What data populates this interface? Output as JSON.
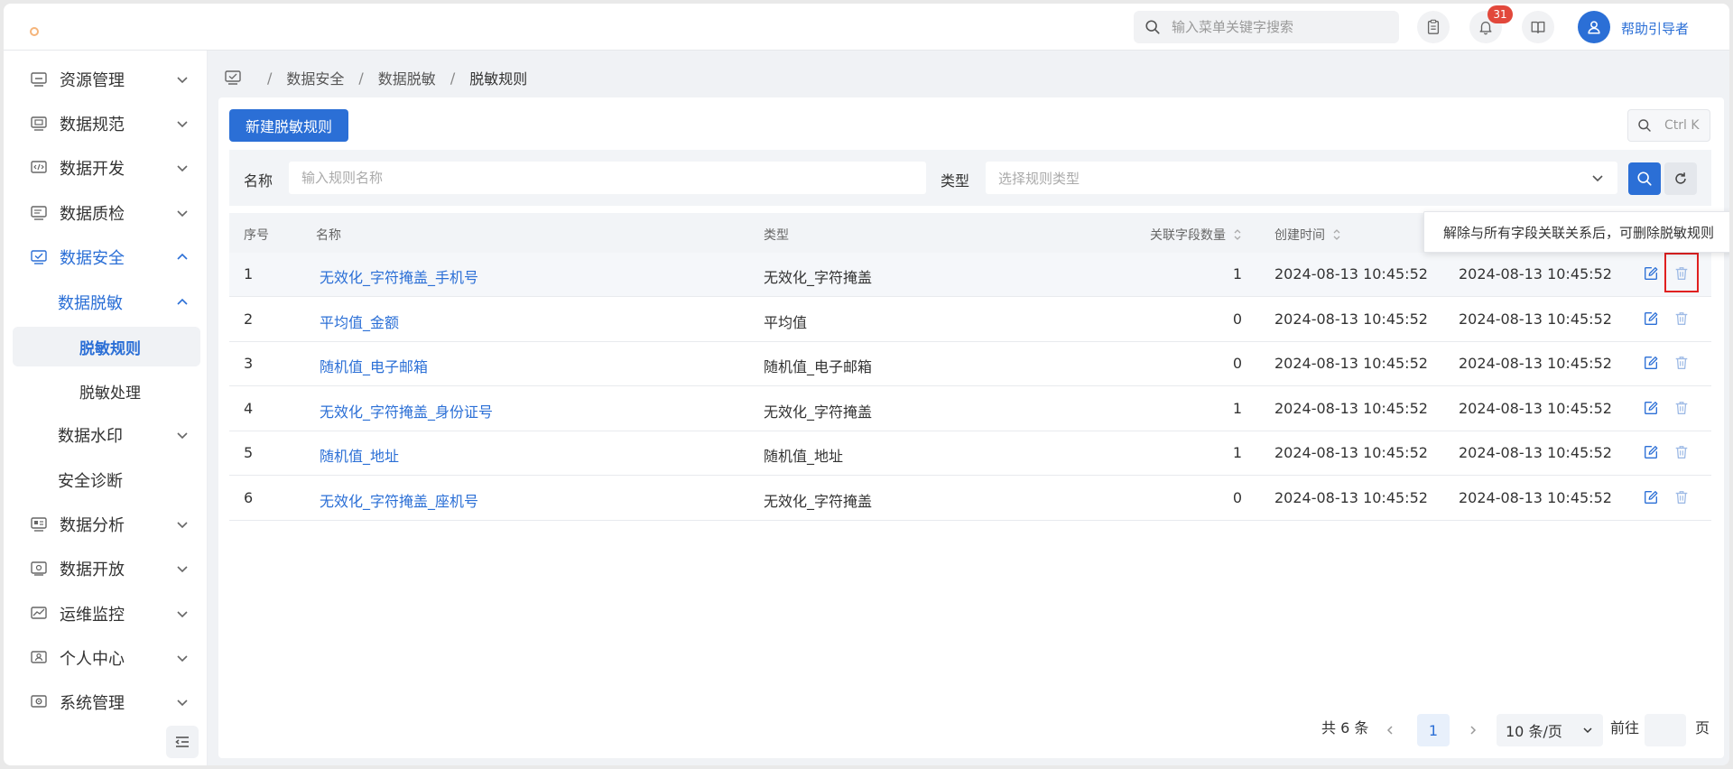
{
  "topbar": {
    "search_placeholder": "输入菜单关键字搜索",
    "notification_count": "31",
    "username": "帮助引导者"
  },
  "sidebar": {
    "items": [
      {
        "label": "资源管理",
        "icon": "resource-icon"
      },
      {
        "label": "数据规范",
        "icon": "standard-icon"
      },
      {
        "label": "数据开发",
        "icon": "code-icon"
      },
      {
        "label": "数据质检",
        "icon": "quality-icon"
      },
      {
        "label": "数据安全",
        "icon": "security-icon"
      },
      {
        "label": "数据脱敏"
      },
      {
        "label": "脱敏规则"
      },
      {
        "label": "脱敏处理"
      },
      {
        "label": "数据水印"
      },
      {
        "label": "安全诊断"
      },
      {
        "label": "数据分析",
        "icon": "analysis-icon"
      },
      {
        "label": "数据开放",
        "icon": "open-icon"
      },
      {
        "label": "运维监控",
        "icon": "monitor-icon"
      },
      {
        "label": "个人中心",
        "icon": "user-center-icon"
      },
      {
        "label": "系统管理",
        "icon": "system-icon"
      }
    ]
  },
  "breadcrumb": [
    "数据安全",
    "数据脱敏",
    "脱敏规则"
  ],
  "toolbar": {
    "new_button": "新建脱敏规则",
    "shortcut": "Ctrl K"
  },
  "filter": {
    "name_label": "名称",
    "name_placeholder": "输入规则名称",
    "type_label": "类型",
    "type_placeholder": "选择规则类型"
  },
  "table": {
    "columns": [
      "序号",
      "名称",
      "类型",
      "关联字段数量",
      "创建时间"
    ],
    "rows": [
      {
        "index": "1",
        "name": "无效化_字符掩盖_手机号",
        "type": "无效化_字符掩盖",
        "count": "1",
        "created": "2024-08-13 10:45:52",
        "updated": "2024-08-13 10:45:52"
      },
      {
        "index": "2",
        "name": "平均值_金额",
        "type": "平均值",
        "count": "0",
        "created": "2024-08-13 10:45:52",
        "updated": "2024-08-13 10:45:52"
      },
      {
        "index": "3",
        "name": "随机值_电子邮箱",
        "type": "随机值_电子邮箱",
        "count": "0",
        "created": "2024-08-13 10:45:52",
        "updated": "2024-08-13 10:45:52"
      },
      {
        "index": "4",
        "name": "无效化_字符掩盖_身份证号",
        "type": "无效化_字符掩盖",
        "count": "1",
        "created": "2024-08-13 10:45:52",
        "updated": "2024-08-13 10:45:52"
      },
      {
        "index": "5",
        "name": "随机值_地址",
        "type": "随机值_地址",
        "count": "1",
        "created": "2024-08-13 10:45:52",
        "updated": "2024-08-13 10:45:52"
      },
      {
        "index": "6",
        "name": "无效化_字符掩盖_座机号",
        "type": "无效化_字符掩盖",
        "count": "0",
        "created": "2024-08-13 10:45:52",
        "updated": "2024-08-13 10:45:52"
      }
    ]
  },
  "tooltip": "解除与所有字段关联关系后，可删除脱敏规则",
  "pagination": {
    "total": "共 6 条",
    "current_page": "1",
    "page_size": "10 条/页",
    "goto_prefix": "前往",
    "goto_suffix": "页"
  },
  "colors": {
    "primary": "#2b6fd6",
    "highlight": "#e02020",
    "badge": "#e2483b"
  }
}
